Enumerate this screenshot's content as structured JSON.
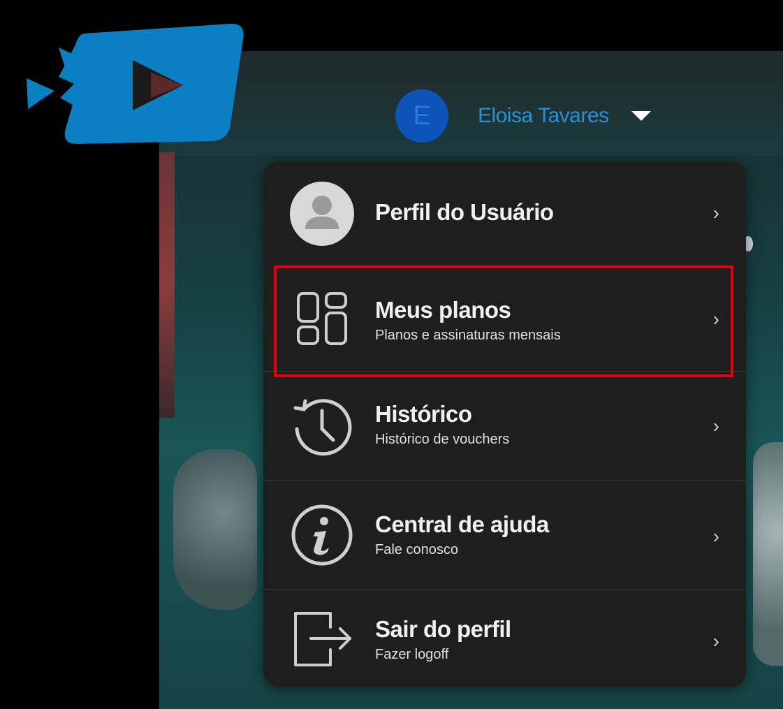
{
  "brand": {
    "logo_icon": "play-logo-icon",
    "color": "#0a7fc2"
  },
  "user": {
    "avatar_initial": "E",
    "name": "Eloisa Tavares",
    "caret_icon": "caret-down-icon",
    "avatar_color": "#0e54b8"
  },
  "menu": {
    "items": [
      {
        "title": "Perfil do Usuário",
        "subtitle": "",
        "icon": "user-avatar-icon",
        "chevron": "›"
      },
      {
        "title": "Meus planos",
        "subtitle": "Planos e assinaturas mensais",
        "icon": "plans-grid-icon",
        "chevron": "›",
        "highlighted": true
      },
      {
        "title": "Histórico",
        "subtitle": "Histórico de vouchers",
        "icon": "history-clock-icon",
        "chevron": "›"
      },
      {
        "title": "Central de ajuda",
        "subtitle": "Fale conosco",
        "icon": "info-icon",
        "chevron": "›"
      },
      {
        "title": "Sair do perfil",
        "subtitle": "Fazer logoff",
        "icon": "logout-icon",
        "chevron": "›"
      }
    ]
  },
  "colors": {
    "menu_bg": "#1e1e1f",
    "highlight": "#e3000f",
    "user_name": "#2d8fd5"
  }
}
